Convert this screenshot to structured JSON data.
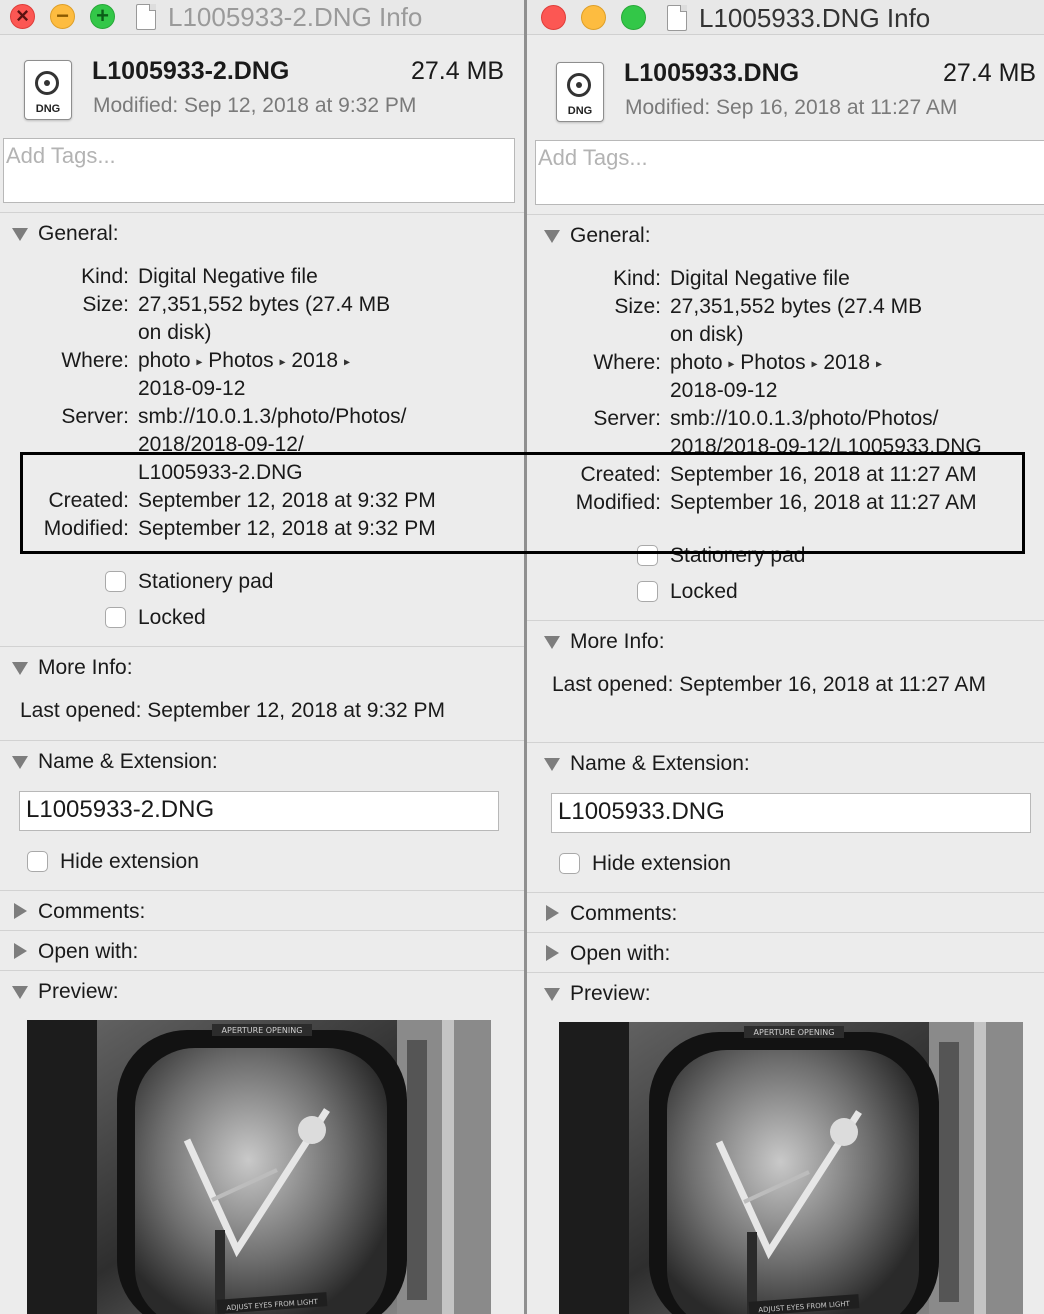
{
  "left": {
    "title": "L1005933-2.DNG Info",
    "file_name": "L1005933-2.DNG",
    "file_size": "27.4 MB",
    "header_modified": "Modified:  Sep 12, 2018 at 9:32 PM",
    "icon_ext": "DNG",
    "tags_placeholder": "Add Tags...",
    "general_label": "General:",
    "kind_label": "Kind:",
    "kind_value": "Digital Negative file",
    "size_label": "Size:",
    "size_value_1": "27,351,552 bytes (27.4 MB",
    "size_value_2": "on disk)",
    "where_label": "Where:",
    "where_path": [
      "photo",
      "Photos",
      "2018"
    ],
    "where_line2": "2018-09-12",
    "server_label": "Server:",
    "server_line1": "smb://10.0.1.3/photo/Photos/",
    "server_line2": "2018/2018-09-12/",
    "server_line3": "L1005933-2.DNG",
    "created_label": "Created:",
    "created_value": "September 12, 2018 at 9:32 PM",
    "modified_label": "Modified:",
    "modified_value": "September 12, 2018 at 9:32 PM",
    "stationery_label": "Stationery pad",
    "locked_label": "Locked",
    "more_info_label": "More Info:",
    "last_opened_label": "Last opened:",
    "last_opened_value": "September 12, 2018 at 9:32 PM",
    "name_ext_label": "Name & Extension:",
    "name_value": "L1005933-2.DNG",
    "hide_ext_label": "Hide extension",
    "comments_label": "Comments:",
    "open_with_label": "Open with:",
    "preview_label": "Preview:"
  },
  "right": {
    "title": "L1005933.DNG Info",
    "file_name": "L1005933.DNG",
    "file_size": "27.4 MB",
    "header_modified": "Modified:  Sep 16, 2018 at 11:27 AM",
    "icon_ext": "DNG",
    "tags_placeholder": "Add Tags...",
    "general_label": "General:",
    "kind_label": "Kind:",
    "kind_value": "Digital Negative file",
    "size_label": "Size:",
    "size_value_1": "27,351,552 bytes (27.4 MB",
    "size_value_2": "on disk)",
    "where_label": "Where:",
    "where_path": [
      "photo",
      "Photos",
      "2018"
    ],
    "where_line2": "2018-09-12",
    "server_label": "Server:",
    "server_line1": "smb://10.0.1.3/photo/Photos/",
    "server_line2": "2018/2018-09-12/L1005933.DNG",
    "created_label": "Created:",
    "created_value": "September 16, 2018 at 11:27 AM",
    "modified_label": "Modified:",
    "modified_value": "September 16, 2018 at 11:27 AM",
    "stationery_label": "Stationery pad",
    "locked_label": "Locked",
    "more_info_label": "More Info:",
    "last_opened_label": "Last opened:",
    "last_opened_value": "September 16, 2018 at 11:27 AM",
    "name_ext_label": "Name & Extension:",
    "name_value": "L1005933.DNG",
    "hide_ext_label": "Hide extension",
    "comments_label": "Comments:",
    "open_with_label": "Open with:",
    "preview_label": "Preview:"
  },
  "preview_photo_text": [
    "APERTURE OPENING",
    "ADJUST EYES FROM LIGHT"
  ]
}
